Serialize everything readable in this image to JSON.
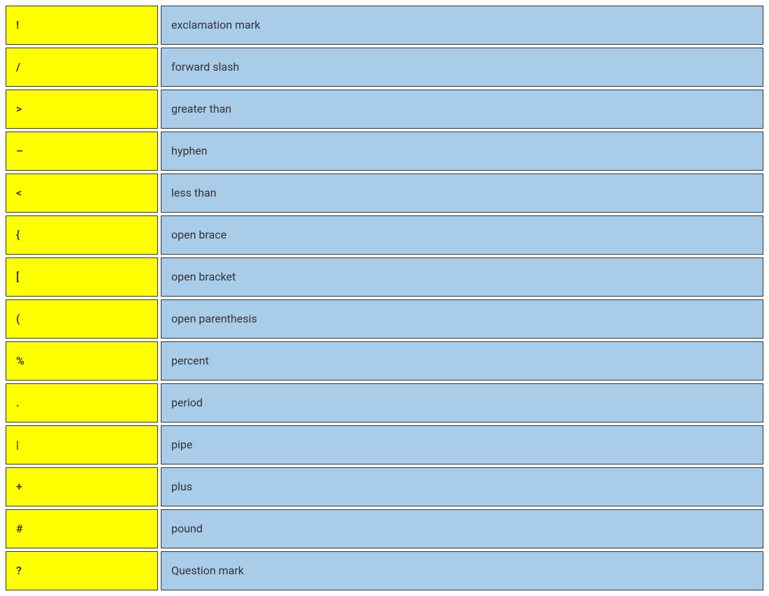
{
  "colors": {
    "symbol_bg": "#ffff00",
    "name_bg": "#a9cce9",
    "border": "#333333",
    "text": "#333333"
  },
  "rows": [
    {
      "symbol": "!",
      "name": "exclamation mark"
    },
    {
      "symbol": "/",
      "name": "forward slash"
    },
    {
      "symbol": ">",
      "name": "greater than"
    },
    {
      "symbol": "–",
      "name": "hyphen"
    },
    {
      "symbol": "<",
      "name": "less than"
    },
    {
      "symbol": "{",
      "name": "open brace"
    },
    {
      "symbol": "[",
      "name": "open bracket"
    },
    {
      "symbol": "(",
      "name": "open parenthesis"
    },
    {
      "symbol": "%",
      "name": "percent"
    },
    {
      "symbol": ".",
      "name": "period"
    },
    {
      "symbol": "|",
      "name": "pipe"
    },
    {
      "symbol": "+",
      "name": "plus"
    },
    {
      "symbol": "#",
      "name": "pound"
    },
    {
      "symbol": "?",
      "name": "Question mark"
    }
  ]
}
